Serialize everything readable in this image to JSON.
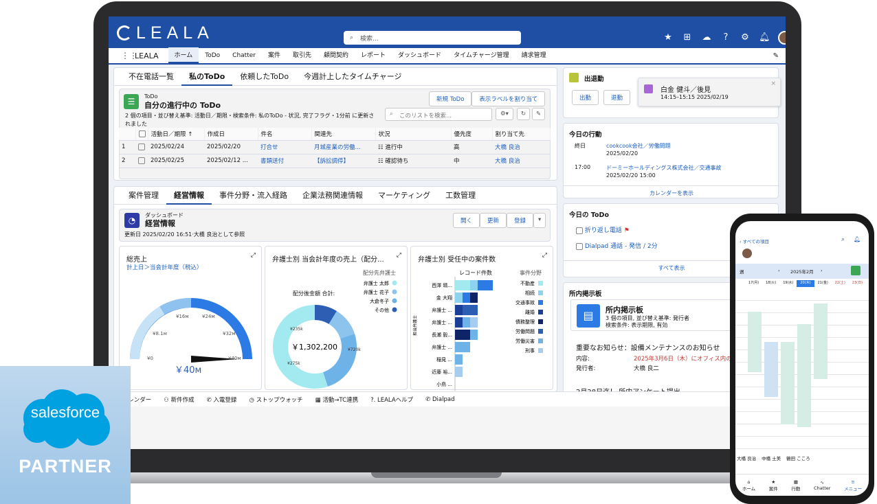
{
  "laptop": {
    "brand": "LEALA",
    "search_placeholder": "検索...",
    "nav": {
      "app": "LEALA",
      "items": [
        "ホーム",
        "ToDo",
        "Chatter",
        "案件",
        "取引先",
        "顧問契約",
        "レポート",
        "ダッシュボード",
        "タイムチャージ管理",
        "請求管理"
      ]
    },
    "todo_tabs": [
      "不在電話一覧",
      "私のToDo",
      "依頼したToDo",
      "今週計上したタイムチャージ"
    ],
    "todo": {
      "object": "ToDo",
      "title": "自分の進行中の ToDo",
      "meta": "2 個の項目・並び替え基準: 活動日／期限・検索条件: 私のToDo - 状況, 完了フラグ・1分前 に更新されました",
      "new_btn": "新規 ToDo",
      "label_btn": "表示ラベルを割り当て",
      "search": "このリストを検索...",
      "columns": [
        "活動日／期限 ↑",
        "作成日",
        "件名",
        "関連先",
        "状況",
        "優先度",
        "割り当て先"
      ],
      "rows": [
        {
          "n": "1",
          "due": "2025/02/24",
          "created": "2025/02/20",
          "subject": "打合せ",
          "related": "月城産業の労働...",
          "status": "進行中",
          "priority": "高",
          "owner": "大橋 良治"
        },
        {
          "n": "2",
          "due": "2025/02/25",
          "created": "2025/02/12 ...",
          "subject": "書類送付",
          "related": "【訴訟調停】",
          "status": "確認待ち",
          "priority": "中",
          "owner": "大橋 良治"
        }
      ]
    },
    "dash_tabs": [
      "案件管理",
      "経営情報",
      "事件分野・流入経路",
      "企業法務関連情報",
      "マーケティング",
      "工数管理"
    ],
    "dash": {
      "object": "ダッシュボード",
      "title": "経営情報",
      "updated": "更新日 2025/02/20 16:51·大橋 良治として参照",
      "open": "開く",
      "refresh": "更新",
      "subscribe": "登録"
    },
    "gauge": {
      "title": "総売上",
      "subtitle": "計上日＞当会計年度（税込）",
      "value_label": "￥40м",
      "ticks": [
        "¥0",
        "¥8.1м",
        "¥16м",
        "¥24м",
        "¥32м",
        "¥40м"
      ]
    },
    "donut": {
      "title": "弁護士別 当会計年度の売上（配分...",
      "legend_title": "配分先弁護士",
      "center_label": "配分後金額 合計:",
      "total": "￥1,302,200",
      "labels": [
        "¥235k",
        "¥275k",
        "¥720k"
      ]
    },
    "hbar": {
      "title": "弁護士別 受任中の案件数",
      "axis_title": "レコード件数",
      "legend_title": "事件分野",
      "y_title": "担当弁護士",
      "rows": [
        "西澤 晴...",
        "金 大翔",
        "弁護士 ...",
        "弁護士 ...",
        "長瀬 毅...",
        "弁護士 ...",
        "稲見 ...",
        "近藤 裕...",
        "小鳥 ..."
      ],
      "legend": [
        "不動産",
        "相続",
        "交通事故",
        "離婚",
        "債務整理",
        "労働問題",
        "労働災害",
        "刑事"
      ]
    },
    "kintai": {
      "title": "出退勤",
      "in": "出勤",
      "out": "退勤",
      "toast_name": "白金 健斗／後見",
      "toast_time": "14:15–15:15 2025/02/19"
    },
    "today": {
      "title": "今日の行動",
      "items": [
        {
          "time": "終日",
          "name": "cookcook会社／労働問題",
          "sub": "2025/02/20"
        },
        {
          "time": "17:00",
          "name": "ドーミーホールディングス株式会社／交通事故",
          "sub": "2025/02/20 15:00"
        }
      ],
      "link": "カレンダーを表示"
    },
    "todo_today": {
      "title": "今日の ToDo",
      "items": [
        "折り返し電話",
        "Dialpad 通話 - 発信 / 2分"
      ],
      "link": "すべて表示"
    },
    "board": {
      "title": "所内掲示板",
      "name": "所内掲示板",
      "meta1": "3 個の項目, 並び替え基準: 発行者",
      "meta2": "検索条件: 表示期限, 有効",
      "post_title": "重要なお知らせ：設備メンテナンスのお知らせ",
      "content_label": "内容:",
      "content_value": "2025年3月6日（木）にオフィス内の",
      "issuer_label": "発行者:",
      "issuer": "大橋 良二",
      "post2": "2月28日迄！ 所内アンケート提出"
    },
    "dock": [
      "カレンダー",
      "新件作成",
      "入電登録",
      "ストップウォッチ",
      "活動→TC連携",
      "LEALAヘルプ",
      "Dialpad"
    ]
  },
  "badge": {
    "brand": "salesforce",
    "label": "PARTNER"
  },
  "phone": {
    "back": "すべての項目",
    "month": "2025年2月",
    "view": "週",
    "days": [
      "17(月)",
      "18(火)",
      "19(水)",
      "20(木)",
      "21(金)",
      "22(土)",
      "23(日)"
    ],
    "tabs": [
      "ホーム",
      "案件",
      "行動",
      "Chatter",
      "メニュー"
    ],
    "legend": [
      "大橋 良治",
      "中橋 土美",
      "鶴田 こころ"
    ]
  }
}
